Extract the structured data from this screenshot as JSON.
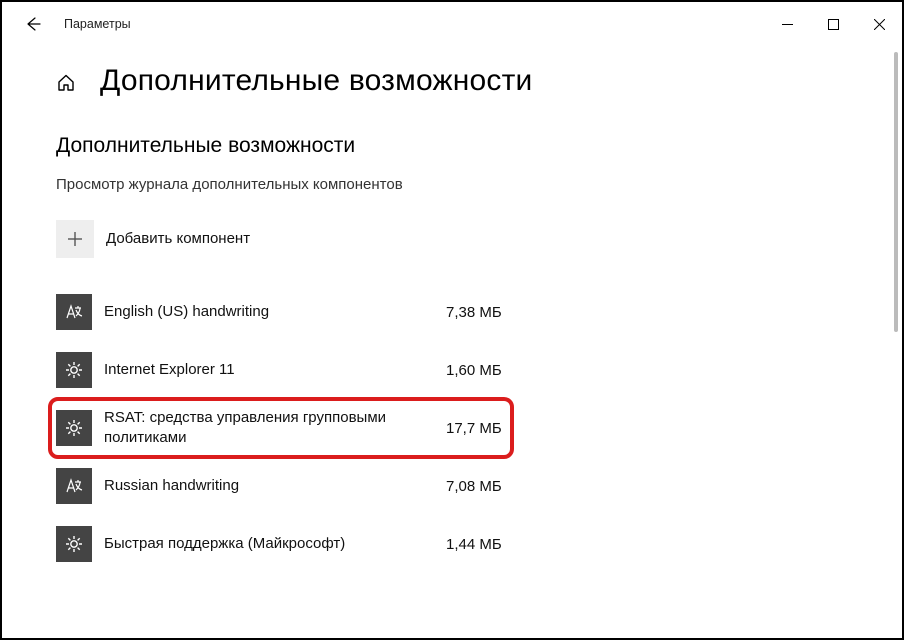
{
  "window": {
    "title": "Параметры"
  },
  "page": {
    "heading": "Дополнительные возможности",
    "section_title": "Дополнительные возможности",
    "history_link": "Просмотр журнала дополнительных компонентов",
    "add_label": "Добавить компонент"
  },
  "items": [
    {
      "icon": "lang",
      "name": "English (US) handwriting",
      "size": "7,38 МБ"
    },
    {
      "icon": "gear",
      "name": "Internet Explorer 11",
      "size": "1,60 МБ"
    },
    {
      "icon": "gear",
      "name": "RSAT: средства управления групповыми политиками",
      "size": "17,7 МБ"
    },
    {
      "icon": "lang",
      "name": "Russian handwriting",
      "size": "7,08 МБ"
    },
    {
      "icon": "gear",
      "name": "Быстрая поддержка (Майкрософт)",
      "size": "1,44 МБ"
    }
  ]
}
